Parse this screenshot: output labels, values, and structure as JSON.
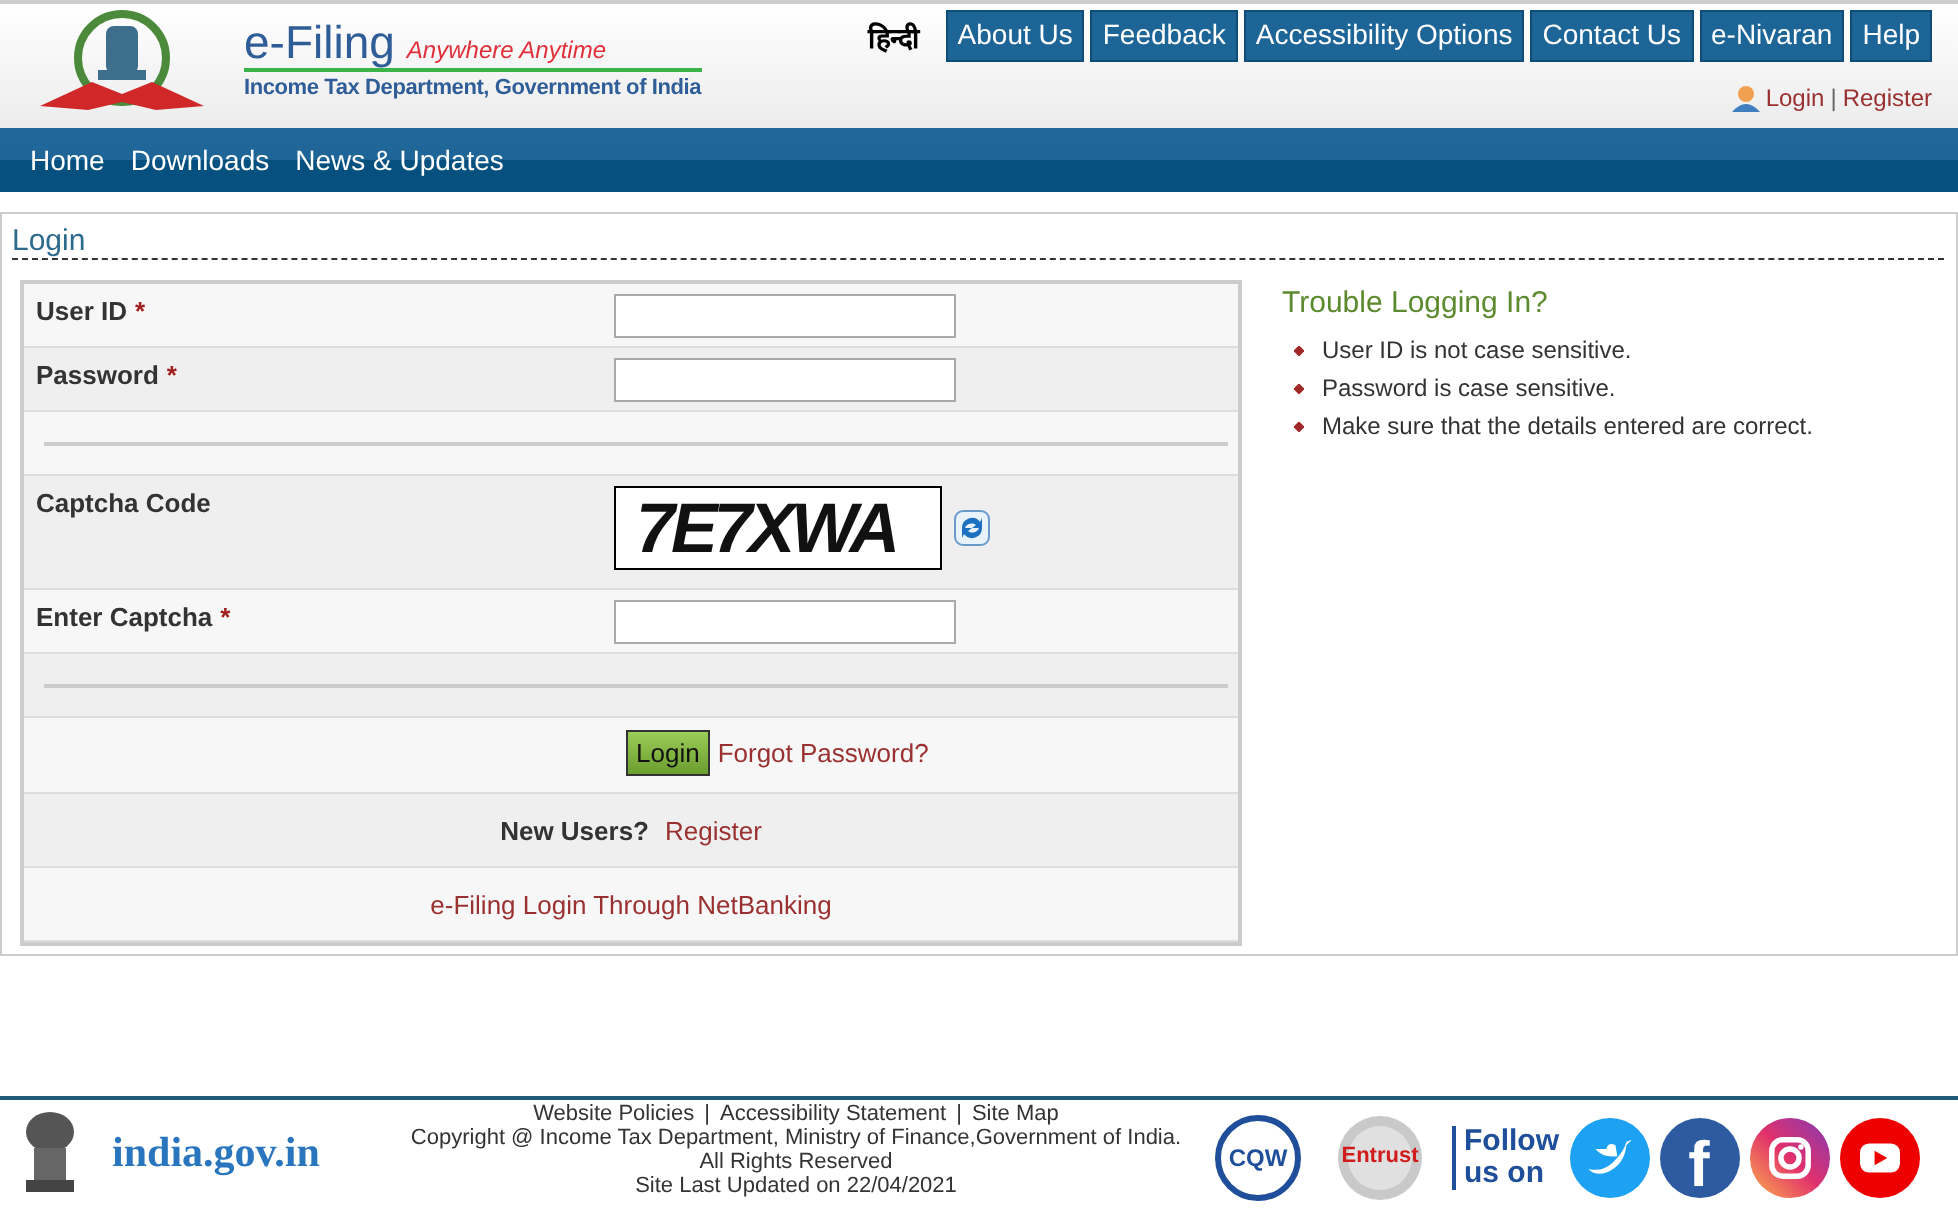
{
  "header": {
    "brand": "e-Filing",
    "tagline": "Anywhere Anytime",
    "subtitle": "Income Tax Department, Government of India",
    "language_link": "हिन्दी",
    "top_menu": [
      {
        "label": "About Us"
      },
      {
        "label": "Feedback"
      },
      {
        "label": "Accessibility Options"
      },
      {
        "label": "Contact Us"
      },
      {
        "label": "e-Nivaran"
      },
      {
        "label": "Help"
      }
    ],
    "user_links": [
      {
        "label": "Login"
      },
      {
        "label": "Register"
      }
    ],
    "user_separator": "|"
  },
  "nav": [
    {
      "label": "Home"
    },
    {
      "label": "Downloads"
    },
    {
      "label": "News & Updates"
    }
  ],
  "login": {
    "title": "Login",
    "rows": [
      {
        "kind": "input",
        "label": "User ID",
        "required_mark": "*"
      },
      {
        "kind": "input",
        "label": "Password",
        "required_mark": "*"
      },
      {
        "kind": "divider"
      },
      {
        "kind": "captcha",
        "label": "Captcha Code",
        "code": "7E7XWA"
      },
      {
        "kind": "input",
        "label": "Enter Captcha",
        "required_mark": "*"
      },
      {
        "kind": "divider"
      },
      {
        "kind": "actions",
        "button": "Login",
        "link": "Forgot Password?"
      },
      {
        "kind": "register",
        "prompt": "New Users?",
        "link": "Register"
      },
      {
        "kind": "link",
        "link": "e-Filing Login Through NetBanking"
      }
    ]
  },
  "help": {
    "title": "Trouble Logging In?",
    "items": [
      "User ID is not case sensitive.",
      "Password is case sensitive.",
      "Make sure that the details entered are correct."
    ]
  },
  "footer": {
    "portal": "india.gov.in",
    "links": [
      "Website Policies",
      "Accessibility Statement",
      "Site Map"
    ],
    "link_separator": "|",
    "copyright": "Copyright @ Income Tax Department, Ministry of Finance,Government of India.",
    "rights": "All Rights Reserved",
    "updated": "Site Last Updated on 22/04/2021",
    "badges": [
      "CQW",
      "Entrust"
    ],
    "follow": [
      "Follow",
      "us on"
    ],
    "social": [
      {
        "kind": "twitter"
      },
      {
        "kind": "facebook",
        "glyph": "f"
      },
      {
        "kind": "instagram"
      },
      {
        "kind": "youtube"
      }
    ]
  }
}
